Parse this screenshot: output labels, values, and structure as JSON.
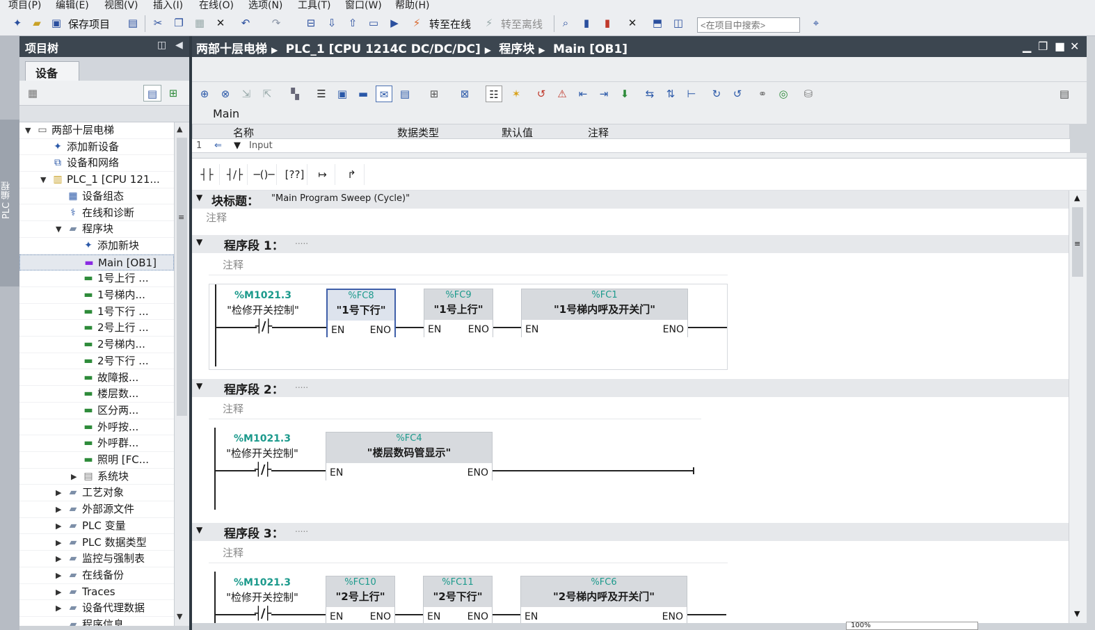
{
  "menu": [
    "项目(P)",
    "编辑(E)",
    "视图(V)",
    "插入(I)",
    "在线(O)",
    "选项(N)",
    "工具(T)",
    "窗口(W)",
    "帮助(H)"
  ],
  "toolbar": {
    "save_label": "保存项目",
    "go_online_label": "转至在线",
    "go_offline_label": "转至离线",
    "search_placeholder": "<在项目中搜索>"
  },
  "left_strip": {
    "label": "PLC 编程"
  },
  "project_tree": {
    "title": "项目树",
    "tab_devices": "设备",
    "items": [
      {
        "label": "两部十层电梯",
        "level": 0,
        "icon": "project-icon",
        "expand": "open"
      },
      {
        "label": "添加新设备",
        "level": 1,
        "icon": "add-device-icon",
        "expand": ""
      },
      {
        "label": "设备和网络",
        "level": 1,
        "icon": "network-icon",
        "expand": ""
      },
      {
        "label": "PLC_1 [CPU 121...",
        "level": 1,
        "icon": "plc-icon",
        "expand": "open"
      },
      {
        "label": "设备组态",
        "level": 2,
        "icon": "device-config-icon",
        "expand": ""
      },
      {
        "label": "在线和诊断",
        "level": 2,
        "icon": "diagnostics-icon",
        "expand": ""
      },
      {
        "label": "程序块",
        "level": 2,
        "icon": "folder-icon",
        "expand": "open"
      },
      {
        "label": "添加新块",
        "level": 3,
        "icon": "add-block-icon",
        "expand": ""
      },
      {
        "label": "Main [OB1]",
        "level": 3,
        "icon": "ob-icon",
        "expand": "",
        "selected": true
      },
      {
        "label": "1号上行 ...",
        "level": 3,
        "icon": "fc-icon",
        "expand": ""
      },
      {
        "label": "1号梯内...",
        "level": 3,
        "icon": "fc-icon",
        "expand": ""
      },
      {
        "label": "1号下行 ...",
        "level": 3,
        "icon": "fc-icon",
        "expand": ""
      },
      {
        "label": "2号上行 ...",
        "level": 3,
        "icon": "fc-icon",
        "expand": ""
      },
      {
        "label": "2号梯内...",
        "level": 3,
        "icon": "fc-icon",
        "expand": ""
      },
      {
        "label": "2号下行 ...",
        "level": 3,
        "icon": "fc-icon",
        "expand": ""
      },
      {
        "label": "故障报...",
        "level": 3,
        "icon": "fc-icon",
        "expand": ""
      },
      {
        "label": "楼层数...",
        "level": 3,
        "icon": "fc-icon",
        "expand": ""
      },
      {
        "label": "区分两...",
        "level": 3,
        "icon": "fc-icon",
        "expand": ""
      },
      {
        "label": "外呼按...",
        "level": 3,
        "icon": "fc-icon",
        "expand": ""
      },
      {
        "label": "外呼群...",
        "level": 3,
        "icon": "fc-icon",
        "expand": ""
      },
      {
        "label": "照明 [FC...",
        "level": 3,
        "icon": "fc-icon",
        "expand": ""
      },
      {
        "label": "系统块",
        "level": 3,
        "icon": "system-block-icon",
        "expand": "closed"
      },
      {
        "label": "工艺对象",
        "level": 2,
        "icon": "folder-icon",
        "expand": "closed"
      },
      {
        "label": "外部源文件",
        "level": 2,
        "icon": "folder-icon",
        "expand": "closed"
      },
      {
        "label": "PLC 变量",
        "level": 2,
        "icon": "folder-icon",
        "expand": "closed"
      },
      {
        "label": "PLC 数据类型",
        "level": 2,
        "icon": "folder-icon",
        "expand": "closed"
      },
      {
        "label": "监控与强制表",
        "level": 2,
        "icon": "folder-icon",
        "expand": "closed"
      },
      {
        "label": "在线备份",
        "level": 2,
        "icon": "folder-icon",
        "expand": "closed"
      },
      {
        "label": "Traces",
        "level": 2,
        "icon": "folder-icon",
        "expand": "closed"
      },
      {
        "label": "设备代理数据",
        "level": 2,
        "icon": "folder-icon",
        "expand": "closed"
      },
      {
        "label": "程序信息",
        "level": 2,
        "icon": "folder-icon",
        "expand": ""
      }
    ]
  },
  "editor": {
    "breadcrumb": [
      "两部十层电梯",
      "PLC_1 [CPU 1214C DC/DC/DC]",
      "程序块",
      "Main [OB1]"
    ],
    "interface_title": "Main",
    "columns": [
      "名称",
      "数据类型",
      "默认值",
      "注释"
    ],
    "interface_row": {
      "num": "1",
      "name": "Input"
    },
    "block_title_label": "块标题：",
    "block_title_value": "\"Main Program Sweep (Cycle)\"",
    "comment_placeholder": "注释",
    "networks": [
      {
        "title": "程序段 1：",
        "dots": ".....",
        "contact": {
          "address": "%M1021.3",
          "name": "\"检修开关控制\""
        },
        "boxes": [
          {
            "address": "%FC8",
            "name": "\"1号下行\"",
            "selected": true
          },
          {
            "address": "%FC9",
            "name": "\"1号上行\""
          },
          {
            "address": "%FC1",
            "name": "\"1号梯内呼及开关门\""
          }
        ]
      },
      {
        "title": "程序段 2：",
        "dots": ".....",
        "contact": {
          "address": "%M1021.3",
          "name": "\"检修开关控制\""
        },
        "boxes": [
          {
            "address": "%FC4",
            "name": "\"楼层数码管显示\""
          }
        ]
      },
      {
        "title": "程序段 3：",
        "dots": ".....",
        "contact": {
          "address": "%M1021.3",
          "name": "\"检修开关控制\""
        },
        "boxes": [
          {
            "address": "%FC10",
            "name": "\"2号上行\""
          },
          {
            "address": "%FC11",
            "name": "\"2号下行\""
          },
          {
            "address": "%FC6",
            "name": "\"2号梯内呼及开关门\""
          }
        ]
      }
    ],
    "en_label": "EN",
    "eno_label": "ENO",
    "zoom": "100%"
  }
}
